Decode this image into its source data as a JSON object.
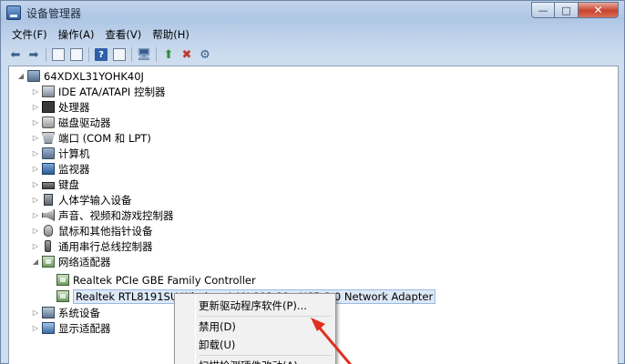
{
  "window": {
    "title": "设备管理器",
    "controls": {
      "minimize": "—",
      "maximize": "□",
      "close": "✕"
    }
  },
  "menubar": [
    "文件(F)",
    "操作(A)",
    "查看(V)",
    "帮助(H)"
  ],
  "toolbar_icons": [
    "back-icon",
    "forward-icon",
    "console-tree-icon",
    "properties-icon",
    "help-icon",
    "action-pane-icon",
    "scan-hardware-icon",
    "update-driver-icon",
    "disable-device-icon",
    "uninstall-device-icon"
  ],
  "tree": {
    "root": "64XDXL31YOHK40J",
    "categories": [
      {
        "label": "IDE ATA/ATAPI 控制器",
        "icon": "ide-controller-icon"
      },
      {
        "label": "处理器",
        "icon": "processor-icon"
      },
      {
        "label": "磁盘驱动器",
        "icon": "disk-drive-icon"
      },
      {
        "label": "端口 (COM 和 LPT)",
        "icon": "port-icon"
      },
      {
        "label": "计算机",
        "icon": "computer-icon"
      },
      {
        "label": "监视器",
        "icon": "monitor-icon"
      },
      {
        "label": "键盘",
        "icon": "keyboard-icon"
      },
      {
        "label": "人体学输入设备",
        "icon": "hid-icon"
      },
      {
        "label": "声音、视频和游戏控制器",
        "icon": "sound-icon"
      },
      {
        "label": "鼠标和其他指针设备",
        "icon": "mouse-icon"
      },
      {
        "label": "通用串行总线控制器",
        "icon": "usb-icon"
      },
      {
        "label": "网络适配器",
        "icon": "network-adapter-icon",
        "expanded": true
      },
      {
        "label": "系统设备",
        "icon": "system-device-icon"
      },
      {
        "label": "显示适配器",
        "icon": "display-adapter-icon"
      }
    ],
    "network_children": [
      {
        "label": "Realtek PCIe GBE Family Controller"
      },
      {
        "label": "Realtek RTL8191SU Wireless LAN 802.11n USB 2.0 Network Adapter",
        "selected": true
      }
    ]
  },
  "context_menu": {
    "items": [
      "更新驱动程序软件(P)...",
      "禁用(D)",
      "卸载(U)",
      "扫描检测硬件改动(A)"
    ]
  },
  "colors": {
    "title_gradient_top": "#c2d4ea",
    "close_button": "#c8432f",
    "selection_bg": "#dde9f7",
    "annotation_arrow": "#e0301e"
  }
}
